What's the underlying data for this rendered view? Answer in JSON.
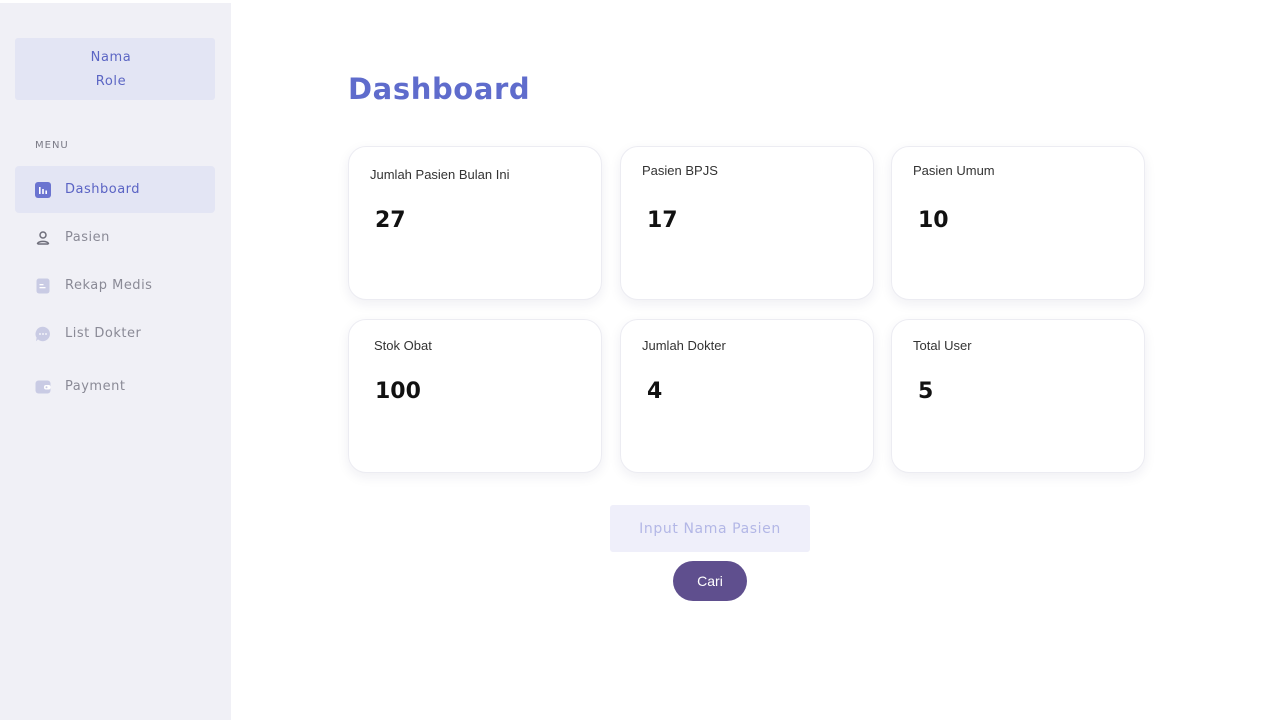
{
  "profile": {
    "name": "Nama",
    "role": "Role"
  },
  "sidebar": {
    "menu_heading": "MENU",
    "items": [
      {
        "label": "Dashboard",
        "icon": "chart-icon",
        "active": true
      },
      {
        "label": "Pasien",
        "icon": "user-icon",
        "active": false
      },
      {
        "label": "Rekap Medis",
        "icon": "document-icon",
        "active": false
      },
      {
        "label": "List Dokter",
        "icon": "chat-icon",
        "active": false
      },
      {
        "label": "Payment",
        "icon": "wallet-icon",
        "active": false
      }
    ]
  },
  "main": {
    "title": "Dashboard",
    "stats": [
      {
        "label": "Jumlah Pasien Bulan Ini",
        "value": "27"
      },
      {
        "label": "Pasien BPJS",
        "value": "17"
      },
      {
        "label": "Pasien Umum",
        "value": "10"
      },
      {
        "label": "Stok Obat",
        "value": "100"
      },
      {
        "label": "Jumlah Dokter",
        "value": "4"
      },
      {
        "label": "Total User",
        "value": "5"
      }
    ],
    "search": {
      "placeholder": "Input Nama Pasien",
      "value": "",
      "button_label": "Cari"
    }
  },
  "colors": {
    "accent": "#5f6ccc",
    "sidebar_bg": "#f0f0f6",
    "active_bg": "#e3e5f4",
    "button_bg": "#5f4f8e"
  }
}
